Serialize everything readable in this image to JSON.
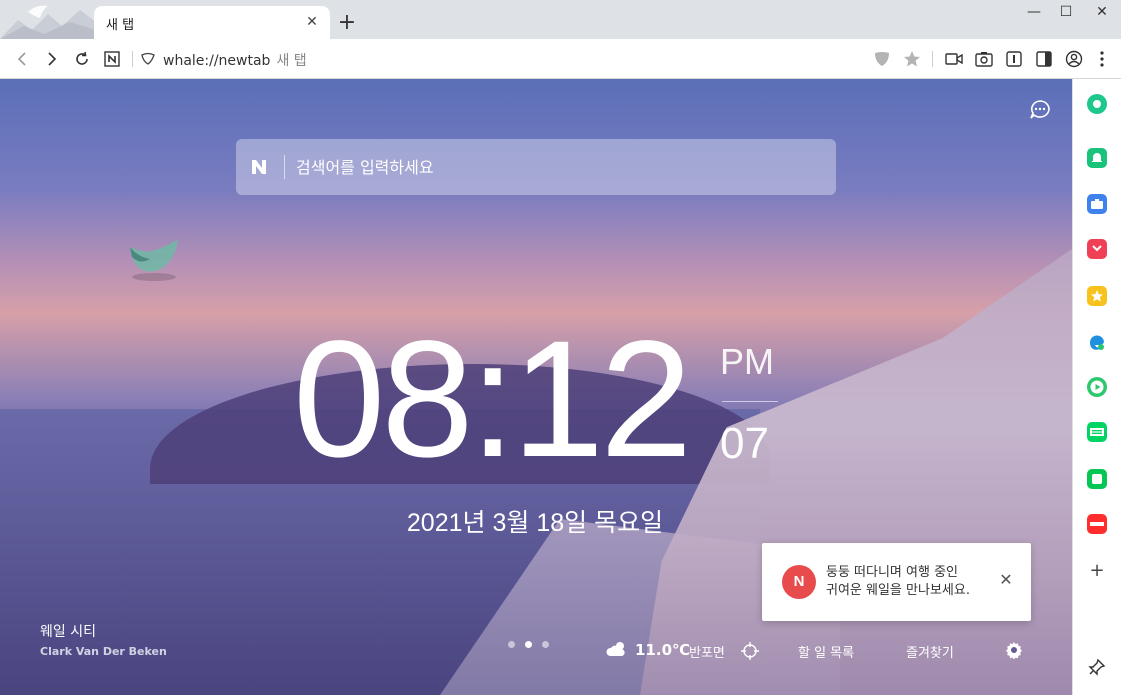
{
  "window": {
    "tab_title": "새 탭",
    "tab_close": "✕",
    "new_tab": "+",
    "minimize": "—",
    "maximize": "☐",
    "close": "✕"
  },
  "toolbar": {
    "url": "whale://newtab",
    "url_subtitle": "새 탭"
  },
  "search": {
    "placeholder": "검색어를 입력하세요",
    "provider_icon": "naver-n-icon"
  },
  "clock": {
    "hours_minutes": "08:12",
    "ampm": "PM",
    "seconds": "07",
    "date": "2021년 3월 18일 목요일"
  },
  "photo": {
    "title": "웨일 시티",
    "author": "Clark Van Der Beken"
  },
  "pager": {
    "count": 3,
    "active_index": 1
  },
  "weather": {
    "temperature": "11.0℃",
    "location": "반포면"
  },
  "bottom_links": {
    "todo": "할 일 목록",
    "favorites": "즐겨찾기"
  },
  "notice": {
    "badge": "N",
    "line1": "둥둥 떠다니며 여행 중인",
    "line2": "귀여운 웨일을 만나보세요.",
    "close": "✕"
  },
  "sidebar": {
    "items": [
      {
        "icon": "green-circle-app-icon",
        "color": "#1ec88a"
      },
      {
        "icon": "bell-app-icon",
        "color": "#19c37a"
      },
      {
        "icon": "toolbox-app-icon",
        "color": "#3f82ee"
      },
      {
        "icon": "pocket-app-icon",
        "color": "#ef4056"
      },
      {
        "icon": "star-app-icon",
        "color": "#f7c21b"
      },
      {
        "icon": "edge-app-icon",
        "color": "#1f8fe0"
      },
      {
        "icon": "play-app-icon",
        "color": "#2cc86d"
      },
      {
        "icon": "webtoon-app-icon",
        "color": "#00d564"
      },
      {
        "icon": "line-app-icon",
        "color": "#06c755"
      },
      {
        "icon": "now-app-icon",
        "color": "#ff2d2d"
      }
    ],
    "add": "+"
  }
}
